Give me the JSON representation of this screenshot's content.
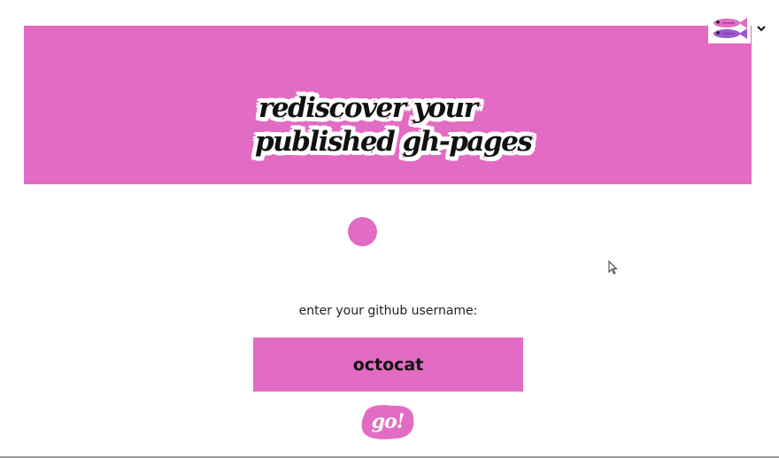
{
  "banner": {
    "headline_line1": "rediscover your",
    "headline_line2": "published gh-pages"
  },
  "account": {
    "avatar_icon": "pink-fish-avatar-icon",
    "menu_icon": "chevron-down-icon"
  },
  "form": {
    "prompt": "enter your github username:",
    "username_value": "octocat",
    "submit_label": "go!"
  },
  "colors": {
    "accent": "#e26bc3",
    "background": "#ffffff",
    "text": "#111111"
  }
}
